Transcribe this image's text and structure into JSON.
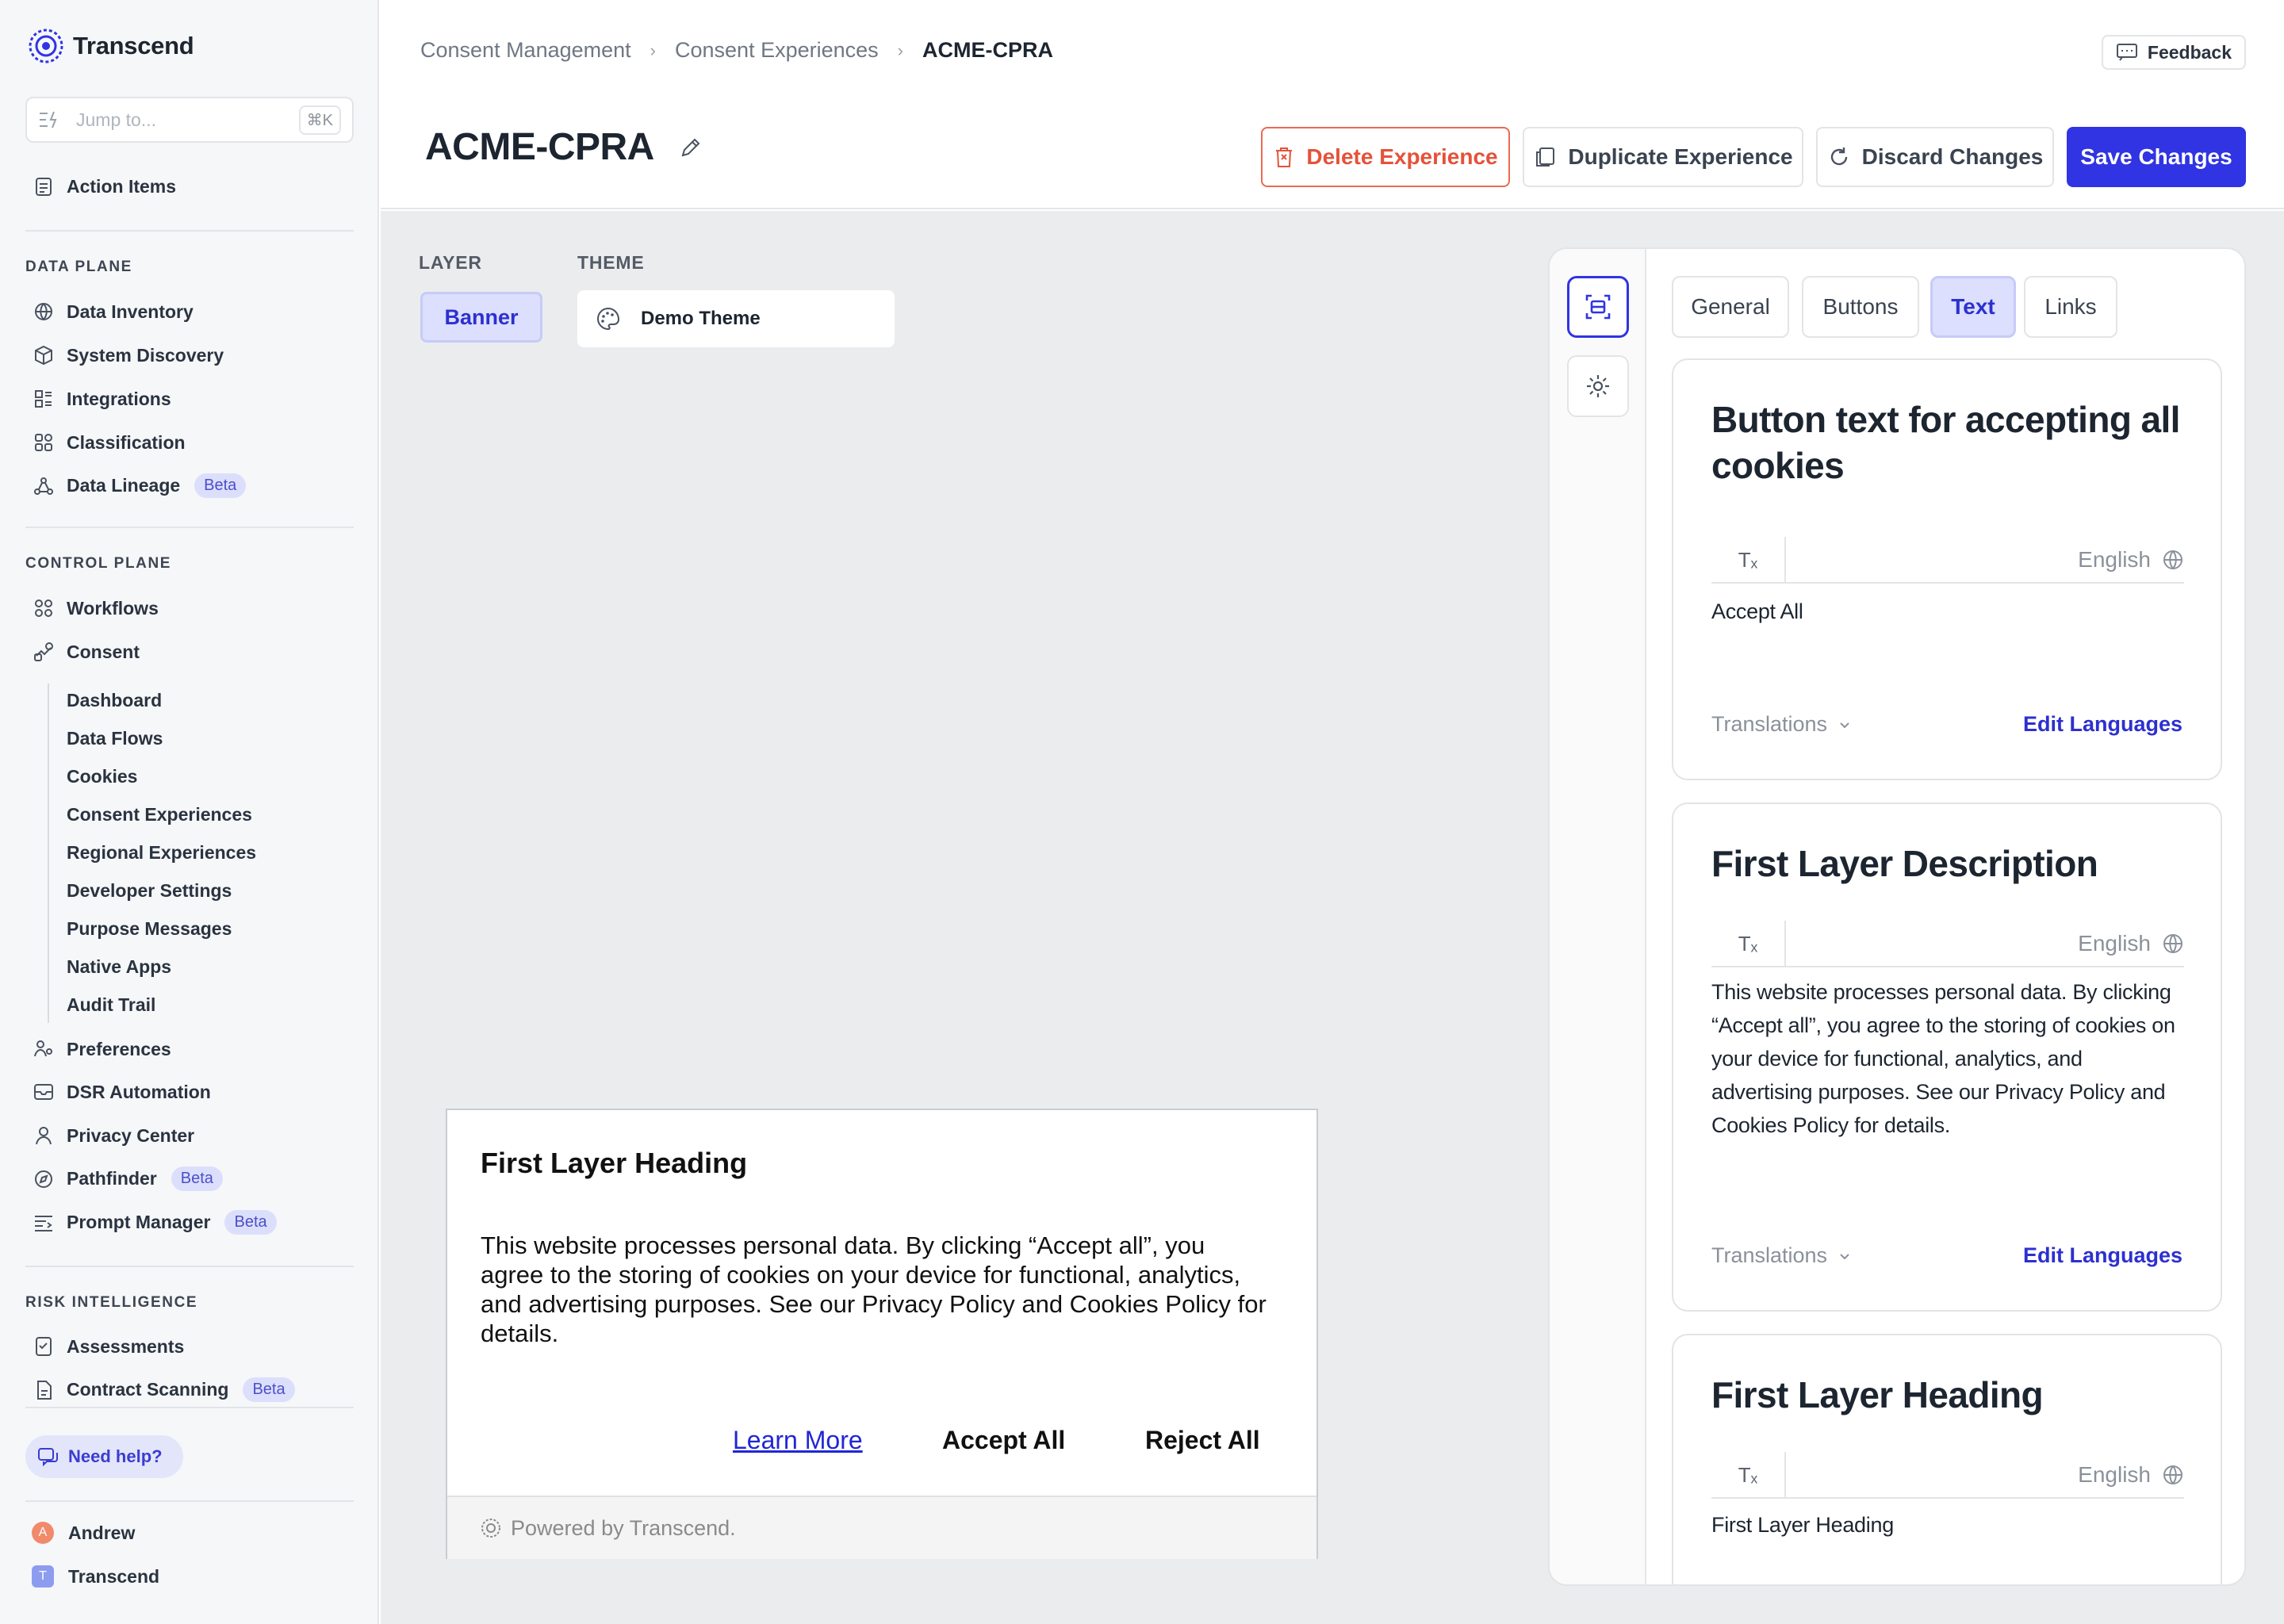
{
  "app": {
    "name": "Transcend"
  },
  "jump": {
    "placeholder": "Jump to...",
    "shortcut": "⌘K"
  },
  "sidebar": {
    "action_items": "Action Items",
    "sections": {
      "data_plane": "DATA PLANE",
      "control_plane": "CONTROL PLANE",
      "risk_intelligence": "RISK INTELLIGENCE"
    },
    "data_plane": [
      "Data Inventory",
      "System Discovery",
      "Integrations",
      "Classification",
      "Data Lineage"
    ],
    "control_plane": [
      "Workflows",
      "Consent"
    ],
    "consent_sub": [
      "Dashboard",
      "Data Flows",
      "Cookies",
      "Consent Experiences",
      "Regional Experiences",
      "Developer Settings",
      "Purpose Messages",
      "Native Apps",
      "Audit Trail"
    ],
    "control_plane_more": [
      "Preferences",
      "DSR Automation",
      "Privacy Center",
      "Pathfinder",
      "Prompt Manager"
    ],
    "risk": [
      "Assessments",
      "Contract Scanning"
    ],
    "beta": "Beta",
    "help": "Need help?",
    "users": [
      {
        "name": "Andrew",
        "initial": "A"
      },
      {
        "name": "Transcend",
        "initial": "T"
      }
    ]
  },
  "breadcrumb": [
    "Consent Management",
    "Consent Experiences",
    "ACME-CPRA"
  ],
  "header": {
    "feedback": "Feedback",
    "title": "ACME-CPRA",
    "delete": "Delete Experience",
    "duplicate": "Duplicate Experience",
    "discard": "Discard Changes",
    "save": "Save Changes"
  },
  "controls": {
    "layer_label": "LAYER",
    "theme_label": "THEME",
    "layer_value": "Banner",
    "theme_value": "Demo Theme"
  },
  "preview": {
    "heading": "First Layer Heading",
    "description": "This website processes personal data. By clicking “Accept all”, you agree to the storing of cookies on your device for functional, analytics, and advertising purposes. See our Privacy Policy and Cookies Policy for details.",
    "learn_more": "Learn More",
    "accept": "Accept All",
    "reject": "Reject All",
    "powered": "Powered by Transcend."
  },
  "editor": {
    "tabs": [
      "General",
      "Buttons",
      "Text",
      "Links"
    ],
    "active_tab": "Text",
    "clear_format": "Tₓ",
    "language": "English",
    "translations": "Translations",
    "edit_languages": "Edit Languages",
    "cards": [
      {
        "title": "Button text for accepting all cookies",
        "value": "Accept All"
      },
      {
        "title": "First Layer Description",
        "value": "This website processes personal data. By clicking “Accept all”, you agree to the storing of cookies on your device for functional, analytics, and advertising purposes. See our Privacy Policy and Cookies Policy for details."
      },
      {
        "title": "First Layer Heading",
        "value": "First Layer Heading"
      }
    ]
  },
  "colors": {
    "accent": "#3034e2",
    "danger": "#e5523a",
    "sidebar_bg": "#f6f7f9",
    "main_bg": "#ebecee"
  }
}
